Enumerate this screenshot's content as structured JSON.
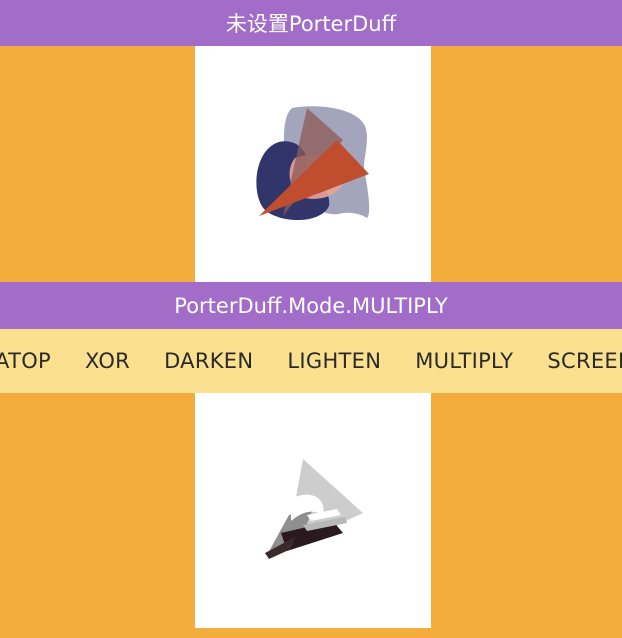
{
  "header": {
    "title": "未设置PorterDuff"
  },
  "mode_bar": {
    "title": "PorterDuff.Mode.MULTIPLY"
  },
  "tabs": {
    "items": [
      {
        "label": "DST_ATOP"
      },
      {
        "label": "XOR"
      },
      {
        "label": "DARKEN"
      },
      {
        "label": "LIGHTEN"
      },
      {
        "label": "MULTIPLY"
      },
      {
        "label": "SCREEN"
      }
    ],
    "selected": "MULTIPLY"
  },
  "colors": {
    "background": "#F2AD3C",
    "bar": "#A16DC8",
    "tab_strip": "#FAE08F",
    "panel": "#FFFFFF"
  }
}
